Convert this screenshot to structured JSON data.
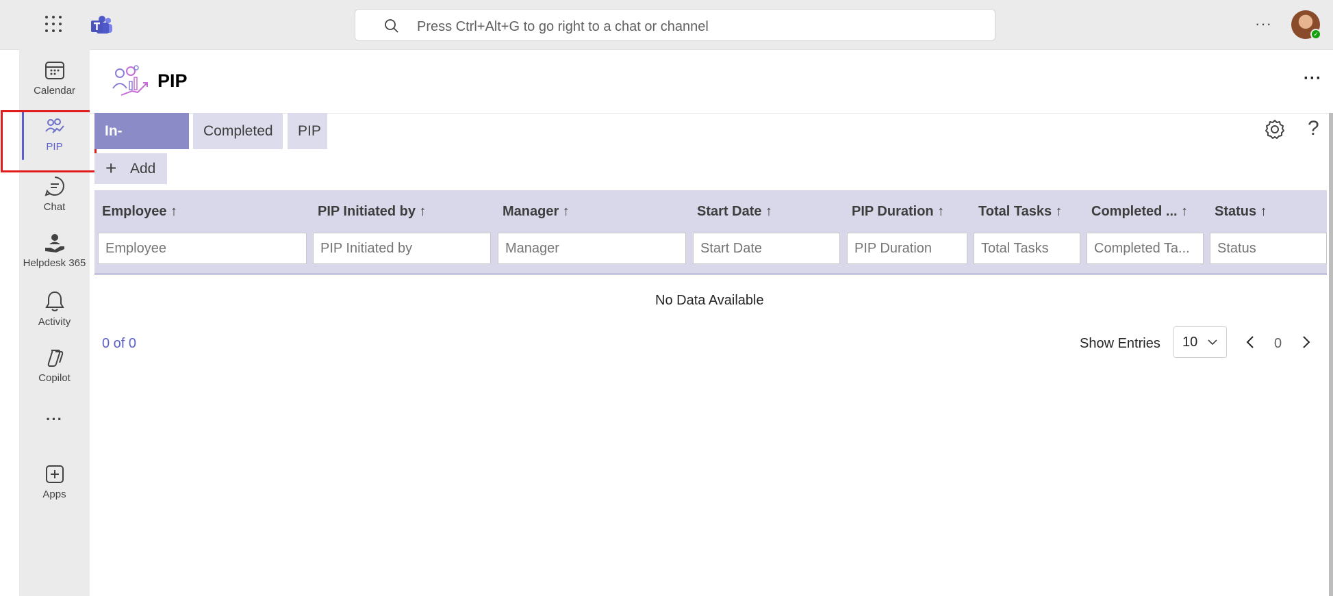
{
  "topbar": {
    "search_placeholder": "Press Ctrl+Alt+G to go right to a chat or channel",
    "more_label": "···"
  },
  "rail": {
    "items": [
      {
        "label": "Calendar",
        "icon": "calendar-icon"
      },
      {
        "label": "PIP",
        "icon": "pip-app-icon",
        "active": true
      },
      {
        "label": "Chat",
        "icon": "chat-icon"
      },
      {
        "label": "Helpdesk 365",
        "icon": "helpdesk-icon"
      },
      {
        "label": "Activity",
        "icon": "bell-icon"
      },
      {
        "label": "Copilot",
        "icon": "copilot-icon"
      },
      {
        "label": "···",
        "icon": "more-icon"
      },
      {
        "label": "Apps",
        "icon": "apps-plus-icon"
      }
    ]
  },
  "app": {
    "title": "PIP",
    "more_label": "···"
  },
  "tabs": [
    {
      "label": "In-Progress",
      "active": true
    },
    {
      "label": "Completed"
    },
    {
      "label": "PIP"
    }
  ],
  "toolbar": {
    "add_label": "Add",
    "help_label": "?"
  },
  "table": {
    "columns": [
      {
        "header": "Employee ↑",
        "filter_placeholder": "Employee"
      },
      {
        "header": "PIP Initiated by ↑",
        "filter_placeholder": "PIP Initiated by"
      },
      {
        "header": "Manager ↑",
        "filter_placeholder": "Manager"
      },
      {
        "header": "Start Date ↑",
        "filter_placeholder": "Start Date"
      },
      {
        "header": "PIP Duration ↑",
        "filter_placeholder": "PIP Duration"
      },
      {
        "header": "Total Tasks ↑",
        "filter_placeholder": "Total Tasks"
      },
      {
        "header": "Completed ... ↑",
        "filter_placeholder": "Completed Ta..."
      },
      {
        "header": "Status ↑",
        "filter_placeholder": "Status"
      }
    ],
    "empty_message": "No Data Available"
  },
  "pagination": {
    "count_text": "0 of 0",
    "show_entries_label": "Show Entries",
    "page_size": "10",
    "current_page": "0"
  },
  "colors": {
    "accent": "#5b5fc7",
    "tab_active": "#8b8cc7",
    "tab_idle": "#dcdcec",
    "highlight_box": "#e01c1c"
  }
}
